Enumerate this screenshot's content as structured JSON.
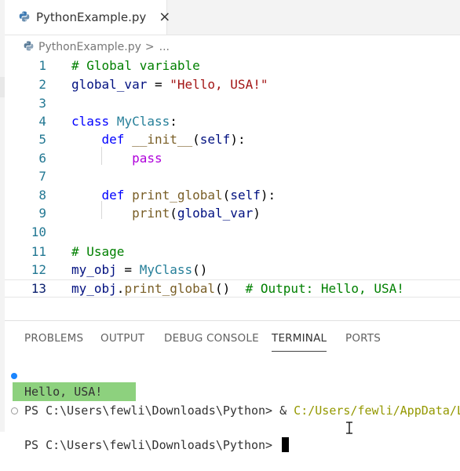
{
  "tab": {
    "label": "PythonExample.py",
    "close": "×"
  },
  "breadcrumb": {
    "file": "PythonExample.py",
    "separator": ">",
    "more": "..."
  },
  "editor": {
    "lines": [
      {
        "n": "1",
        "tokens": [
          {
            "t": "# Global variable",
            "c": "comment"
          }
        ]
      },
      {
        "n": "2",
        "tokens": [
          {
            "t": "global_var",
            "c": "var"
          },
          {
            "t": " = ",
            "c": "plain"
          },
          {
            "t": "\"Hello, USA!\"",
            "c": "string"
          }
        ]
      },
      {
        "n": "3",
        "tokens": []
      },
      {
        "n": "4",
        "tokens": [
          {
            "t": "class",
            "c": "kw"
          },
          {
            "t": " ",
            "c": "plain"
          },
          {
            "t": "MyClass",
            "c": "class"
          },
          {
            "t": ":",
            "c": "plain"
          }
        ]
      },
      {
        "n": "5",
        "tokens": [
          {
            "t": "    ",
            "c": "plain"
          },
          {
            "t": "def",
            "c": "kw"
          },
          {
            "t": " ",
            "c": "plain"
          },
          {
            "t": "__init__",
            "c": "func"
          },
          {
            "t": "(",
            "c": "plain"
          },
          {
            "t": "self",
            "c": "var"
          },
          {
            "t": "):",
            "c": "plain"
          }
        ]
      },
      {
        "n": "6",
        "tokens": [
          {
            "t": "        ",
            "c": "plain"
          },
          {
            "t": "pass",
            "c": "ctrl"
          }
        ]
      },
      {
        "n": "7",
        "tokens": []
      },
      {
        "n": "8",
        "tokens": [
          {
            "t": "    ",
            "c": "plain"
          },
          {
            "t": "def",
            "c": "kw"
          },
          {
            "t": " ",
            "c": "plain"
          },
          {
            "t": "print_global",
            "c": "func"
          },
          {
            "t": "(",
            "c": "plain"
          },
          {
            "t": "self",
            "c": "var"
          },
          {
            "t": "):",
            "c": "plain"
          }
        ]
      },
      {
        "n": "9",
        "tokens": [
          {
            "t": "        ",
            "c": "plain"
          },
          {
            "t": "print",
            "c": "func"
          },
          {
            "t": "(",
            "c": "plain"
          },
          {
            "t": "global_var",
            "c": "var"
          },
          {
            "t": ")",
            "c": "plain"
          }
        ]
      },
      {
        "n": "10",
        "tokens": []
      },
      {
        "n": "11",
        "tokens": [
          {
            "t": "# Usage",
            "c": "comment"
          }
        ]
      },
      {
        "n": "12",
        "tokens": [
          {
            "t": "my_obj",
            "c": "var"
          },
          {
            "t": " = ",
            "c": "plain"
          },
          {
            "t": "MyClass",
            "c": "class"
          },
          {
            "t": "()",
            "c": "plain"
          }
        ]
      },
      {
        "n": "13",
        "tokens": [
          {
            "t": "my_obj",
            "c": "var"
          },
          {
            "t": ".",
            "c": "plain"
          },
          {
            "t": "print_global",
            "c": "func"
          },
          {
            "t": "()  ",
            "c": "plain"
          },
          {
            "t": "# Output: Hello, USA!",
            "c": "comment"
          }
        ]
      }
    ]
  },
  "panel": {
    "tabs": [
      "PROBLEMS",
      "OUTPUT",
      "DEBUG CONSOLE",
      "TERMINAL",
      "PORTS"
    ],
    "active_tab": "TERMINAL"
  },
  "terminal": {
    "line1_prompt": "PS C:\\Users\\fewli\\Downloads\\Python> & ",
    "line1_path": "C:/Users/fewli/AppData/Lo",
    "output": "Hello, USA!",
    "line3_prompt": "PS C:\\Users\\fewli\\Downloads\\Python> "
  }
}
